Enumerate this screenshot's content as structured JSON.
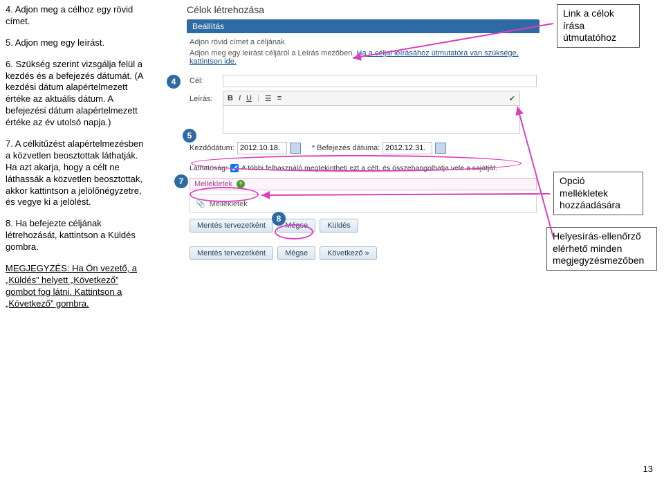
{
  "left": {
    "p4": "4. Adjon meg a célhoz egy rövid címet.",
    "p5": "5. Adjon meg egy leírást.",
    "p6": "6. Szükség szerint vizsgálja felül a kezdés és a befejezés dátumát. (A kezdési dátum alapértelmezett értéke az aktuális dátum. A befejezési dátum alapértelmezett értéke az év utolsó napja.)",
    "p7": "7. A célkitűzést alapértelmezésben a közvetlen beosztottak láthatják. Ha azt akarja, hogy a célt ne láthassák a közvetlen beosztottak, akkor kattintson a jelölőnégyzetre, és vegye ki a jelölést.",
    "p8": "8. Ha befejezte céljának létrehozását, kattintson a Küldés gombra.",
    "note": "MEGJEGYZÉS: Ha Ön vezető, a „Küldés” helyett „Következő” gombot fog látni. Kattintson a „Következő” gombra."
  },
  "center": {
    "title": "Célok létrehozása",
    "tab": "Beállítás",
    "helper1": "Adjon rövid címet a céljának.",
    "helper2a": "Adjon meg egy leírást céljáról a Leírás mezőben. ",
    "helper2link": "Ha a céljai leírásához útmutatóra van szüksége, kattintson ide.",
    "celLabel": "Cél:",
    "leirasLabel": "Leírás:",
    "dateStartLabel": "Kezdődátum:",
    "dateStartVal": "2012.10.18.",
    "dateEndLabel": "* Befejezés dátuma:",
    "dateEndVal": "2012.12.31.",
    "visLabel": "Láthatóság:",
    "visText": "A többi felhasználó megtekintheti ezt a célt, és összehangolhatja vele a sajátját.",
    "mellekTitle": "Mellékletek",
    "mellekBody": "Mellékletek",
    "btn_draft": "Mentés tervezetként",
    "btn_cancel": "Mégse",
    "btn_send": "Küldés",
    "btn_next": "Következő »"
  },
  "badges": {
    "b4": "4",
    "b5": "5",
    "b7": "7",
    "b8": "8"
  },
  "callouts": {
    "c1a": "Link a célok",
    "c1b": "írása",
    "c1c": "útmutatóhoz",
    "c2a": "Opció",
    "c2b": "mellékletek",
    "c2c": "hozzáadására",
    "c3a": "Helyesírás-ellenőrző",
    "c3b": "elérhető minden",
    "c3c": "megjegyzésmezőben"
  },
  "pageNum": "13"
}
